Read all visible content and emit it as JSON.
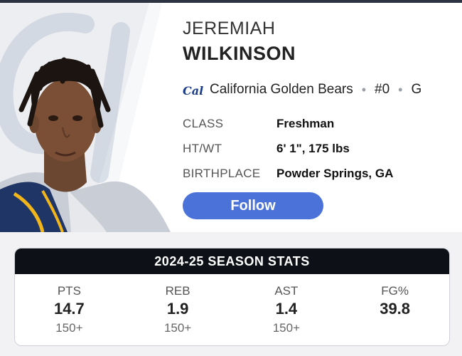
{
  "player": {
    "first_name": "JEREMIAH",
    "last_name": "WILKINSON"
  },
  "team": {
    "logo_text": "Cal",
    "name": "California Golden Bears",
    "number": "#0",
    "position": "G",
    "logo_color": "#1a3a8a"
  },
  "info": [
    {
      "label": "CLASS",
      "value": "Freshman"
    },
    {
      "label": "HT/WT",
      "value": "6' 1\", 175 lbs"
    },
    {
      "label": "BIRTHPLACE",
      "value": "Powder Springs, GA"
    }
  ],
  "follow_label": "Follow",
  "stats": {
    "title": "2024-25 SEASON STATS",
    "items": [
      {
        "label": "PTS",
        "value": "14.7",
        "rank": "150+"
      },
      {
        "label": "REB",
        "value": "1.9",
        "rank": "150+"
      },
      {
        "label": "AST",
        "value": "1.4",
        "rank": "150+"
      },
      {
        "label": "FG%",
        "value": "39.8",
        "rank": ""
      }
    ]
  },
  "colors": {
    "accent": "#4a72d9",
    "stats_header": "#0d1117"
  }
}
